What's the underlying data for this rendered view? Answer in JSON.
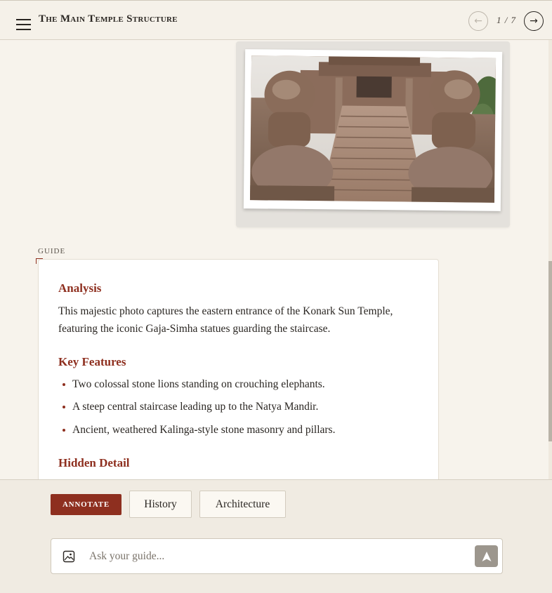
{
  "header": {
    "title": "The Main Temple Structure",
    "page_counter": "1 / 7",
    "prev_icon": "arrow-left-icon",
    "next_icon": "arrow-right-icon",
    "menu_icon": "hamburger-menu-icon"
  },
  "photo": {
    "alt": "Stone lion statues guarding a staircase at the Konark Sun Temple"
  },
  "guide": {
    "label": "GUIDE",
    "analysis_heading": "Analysis",
    "analysis_text": "This majestic photo captures the eastern entrance of the Konark Sun Temple, featuring the iconic Gaja-Simha statues guarding the staircase.",
    "features_heading": "Key Features",
    "features": [
      "Two colossal stone lions standing on crouching elephants.",
      "A steep central staircase leading up to the Natya Mandir.",
      "Ancient, weathered Kalinga-style stone masonry and pillars."
    ],
    "hidden_heading": "Hidden Detail"
  },
  "actions": {
    "annotate_label": "ANNOTATE",
    "history_label": "History",
    "architecture_label": "Architecture"
  },
  "ask": {
    "placeholder": "Ask your guide...",
    "image_icon": "image-icon",
    "send_icon": "send-icon"
  },
  "colors": {
    "accent": "#8e2f1f",
    "background": "#f7f3ec",
    "bar": "#f0ebe2"
  }
}
